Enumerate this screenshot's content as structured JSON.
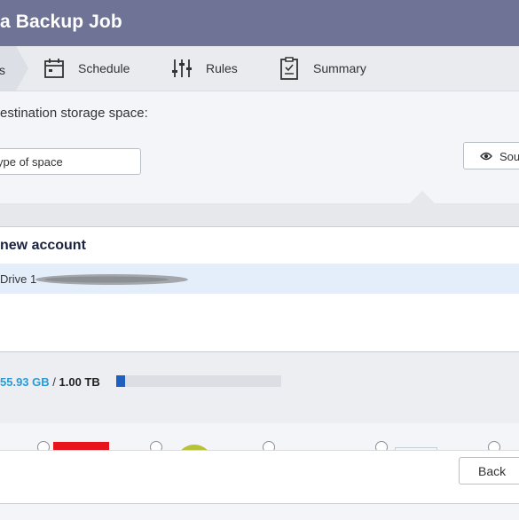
{
  "window": {
    "title": "a Backup Job"
  },
  "steps": [
    {
      "label": "s",
      "icon": "partial-step"
    },
    {
      "label": "Schedule",
      "icon": "calendar-icon"
    },
    {
      "label": "Rules",
      "icon": "sliders-icon"
    },
    {
      "label": "Summary",
      "icon": "clipboard-icon"
    }
  ],
  "destination": {
    "prompt": "estination storage space:",
    "type_select_value": "ype of space",
    "source_button_label": "Sou"
  },
  "account": {
    "header": "new account",
    "selected_row": "Drive 1"
  },
  "storage": {
    "used": "55.93 GB",
    "separator": " / ",
    "total": "1.00 TB",
    "used_fraction": 0.0546
  },
  "footer": {
    "back_label": "Back"
  },
  "colors": {
    "titlebar": "#6f7396",
    "used_text": "#2a9bd8",
    "bar_fill": "#1f5fbf",
    "accent_red": "#e8141b",
    "accent_green": "#b7c23a"
  }
}
